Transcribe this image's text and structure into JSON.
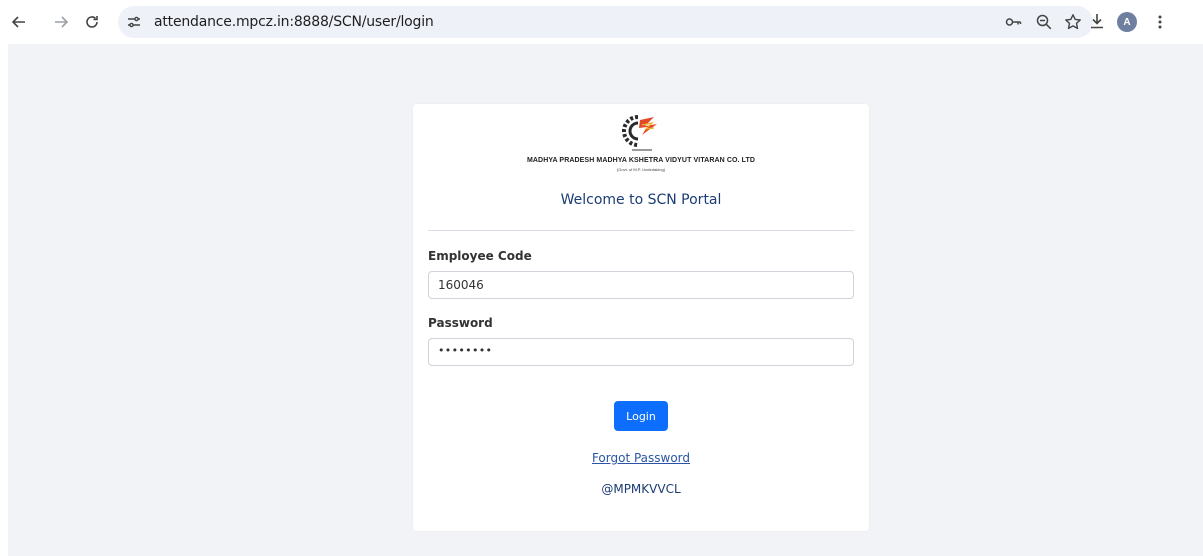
{
  "browser": {
    "url": "attendance.mpcz.in:8888/SCN/user/login",
    "avatar_letter": "A"
  },
  "card": {
    "company_name": "MADHYA PRADESH MADHYA KSHETRA VIDYUT VITARAN CO. LTD",
    "govt_note": "(Govt. of M.P. Undertaking)",
    "welcome": "Welcome to SCN Portal"
  },
  "form": {
    "employee_code_label": "Employee Code",
    "employee_code_value": "160046",
    "password_label": "Password",
    "password_masked": "••••••••",
    "login_label": "Login",
    "forgot_label": "Forgot Password"
  },
  "footer": {
    "text": "@MPMKVVCL"
  },
  "colors": {
    "primary_button": "#0d6efd",
    "heading": "#1b3c74",
    "link": "#2a55a6",
    "background": "#f2f3f7"
  }
}
